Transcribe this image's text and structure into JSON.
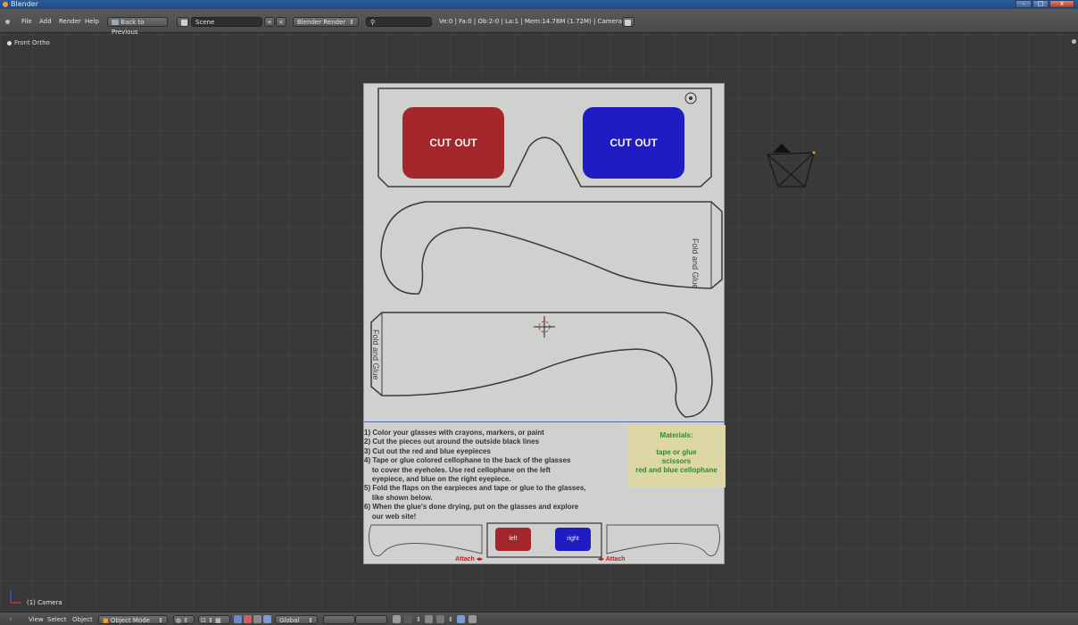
{
  "window": {
    "title": "Blender"
  },
  "info_header": {
    "menus": [
      "File",
      "Add",
      "Render",
      "Help"
    ],
    "back_button": "Back to Previous",
    "scene": "Scene",
    "render_engine": "Blender Render",
    "stats": "Ve:0 | Fa:0 | Ob:2-0 | La:1 | Mem:14.78M (1.72M) | Camera"
  },
  "viewport": {
    "view_label": "Front Ortho",
    "object_label": "(1) Camera"
  },
  "image": {
    "lens_left": "CUT OUT",
    "lens_right": "CUT OUT",
    "fold_label": "Fold and Glue",
    "instructions": [
      "1) Color your glasses with crayons, markers, or paint",
      "2) Cut the pieces out around the outside black lines",
      "3) Cut out the red and blue eyepieces",
      "4) Tape or glue colored cellophane to the back of the glasses",
      "    to cover the eyeholes. Use red cellophane on the left",
      "    eyepiece, and blue on the right eyepiece.",
      "5) Fold the flaps on the earpieces and tape or glue to the glasses,",
      "    like shown below.",
      "6) When the glue's done drying, put on the glasses and explore",
      "    our web site!"
    ],
    "materials": {
      "title": "Materials:",
      "items": [
        "tape or glue",
        "scissors",
        "red and blue cellophane"
      ]
    },
    "mini_left": "left",
    "mini_right": "right",
    "attach_label": "Attach"
  },
  "bottom_header": {
    "menus": [
      "View",
      "Select",
      "Object"
    ],
    "mode": "Object Mode",
    "orientation": "Global"
  },
  "colors": {
    "accent_orange": "#f29a2e",
    "lens_red": "#a3272a",
    "lens_blue": "#1f1cc4"
  }
}
